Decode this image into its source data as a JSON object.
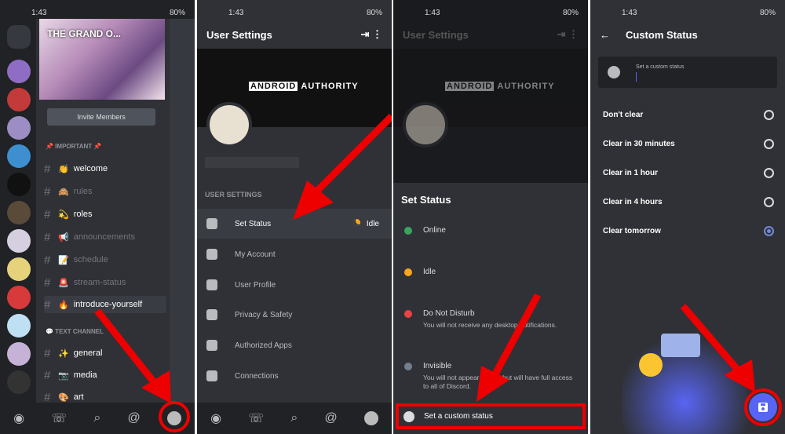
{
  "status_time": "1:43",
  "status_battery": "80%",
  "panel1": {
    "server_name": "THE GRAND O...",
    "invite_label": "Invite Members",
    "category_important": "📌 IMPORTANT 📌",
    "category_text": "💬 TEXT CHANNEL",
    "channels": [
      {
        "name": "welcome",
        "emoji": "👏"
      },
      {
        "name": "rules",
        "emoji": "🙈"
      },
      {
        "name": "roles",
        "emoji": "💫"
      },
      {
        "name": "announcements",
        "emoji": "📢"
      },
      {
        "name": "schedule",
        "emoji": "📝"
      },
      {
        "name": "stream-status",
        "emoji": "🚨"
      },
      {
        "name": "introduce-yourself",
        "emoji": "🔥"
      },
      {
        "name": "general",
        "emoji": "✨"
      },
      {
        "name": "media",
        "emoji": "📷"
      },
      {
        "name": "art",
        "emoji": "🎨"
      }
    ]
  },
  "panel2": {
    "title": "User Settings",
    "banner_logo_a": "ANDROID",
    "banner_logo_b": "AUTHORITY",
    "section": "USER SETTINGS",
    "items": [
      {
        "label": "Set Status",
        "value": "Idle"
      },
      {
        "label": "My Account"
      },
      {
        "label": "User Profile"
      },
      {
        "label": "Privacy & Safety"
      },
      {
        "label": "Authorized Apps"
      },
      {
        "label": "Connections"
      }
    ]
  },
  "panel3": {
    "title": "User Settings",
    "sheet_title": "Set Status",
    "options": [
      {
        "label": "Online",
        "sub": "",
        "color": "#3ba55d"
      },
      {
        "label": "Idle",
        "sub": "",
        "color": "#faa61a"
      },
      {
        "label": "Do Not Disturb",
        "sub": "You will not receive any desktop notifications.",
        "color": "#ed4245"
      },
      {
        "label": "Invisible",
        "sub": "You will not appear online, but will have full access to all of Discord.",
        "color": "#747f8d"
      }
    ],
    "custom_status": "Set a custom status"
  },
  "panel4": {
    "title": "Custom Status",
    "placeholder": "Set a custom status",
    "clear_options": [
      "Don't clear",
      "Clear in 30 minutes",
      "Clear in 1 hour",
      "Clear in 4 hours",
      "Clear tomorrow"
    ],
    "selected_index": 4
  },
  "colors": {
    "highlight": "#ff0000",
    "blurple": "#5865f2"
  }
}
